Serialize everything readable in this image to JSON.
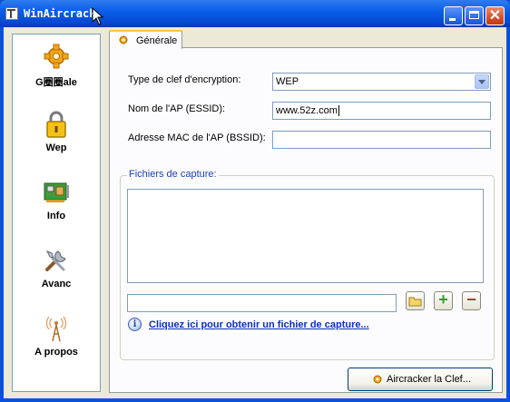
{
  "window": {
    "title": "WinAircrack",
    "close_glyph": "✕"
  },
  "sidebar": {
    "items": [
      {
        "label": "G圈圈ale",
        "icon": "gear-puzzle-icon"
      },
      {
        "label": "Wep",
        "icon": "padlock-icon"
      },
      {
        "label": "Info",
        "icon": "network-card-icon"
      },
      {
        "label": "Avanc",
        "icon": "tools-icon"
      },
      {
        "label": "A propos",
        "icon": "antenna-icon"
      }
    ]
  },
  "tab": {
    "label": "Générale"
  },
  "form": {
    "key_type_label": "Type de clef d'encryption:",
    "key_type_value": "WEP",
    "essid_label": "Nom de l'AP (ESSID):",
    "essid_value": "www.52z.com",
    "bssid_label": "Adresse MAC de l'AP (BSSID):",
    "bssid_value": ""
  },
  "capture": {
    "group_title": "Fichiers de capture:",
    "path_value": "",
    "add_glyph": "+",
    "remove_glyph": "−",
    "link_text": "Cliquez ici pour obtenir un fichier de capture...",
    "info_glyph": "i"
  },
  "actions": {
    "crack_label": "Aircracker la Clef..."
  },
  "colors": {
    "title_bar": "#0a5ee8",
    "link": "#0b2fbd",
    "group_title": "#1a3fb0",
    "add_green": "#2e9e2e",
    "remove_red": "#d22020"
  }
}
